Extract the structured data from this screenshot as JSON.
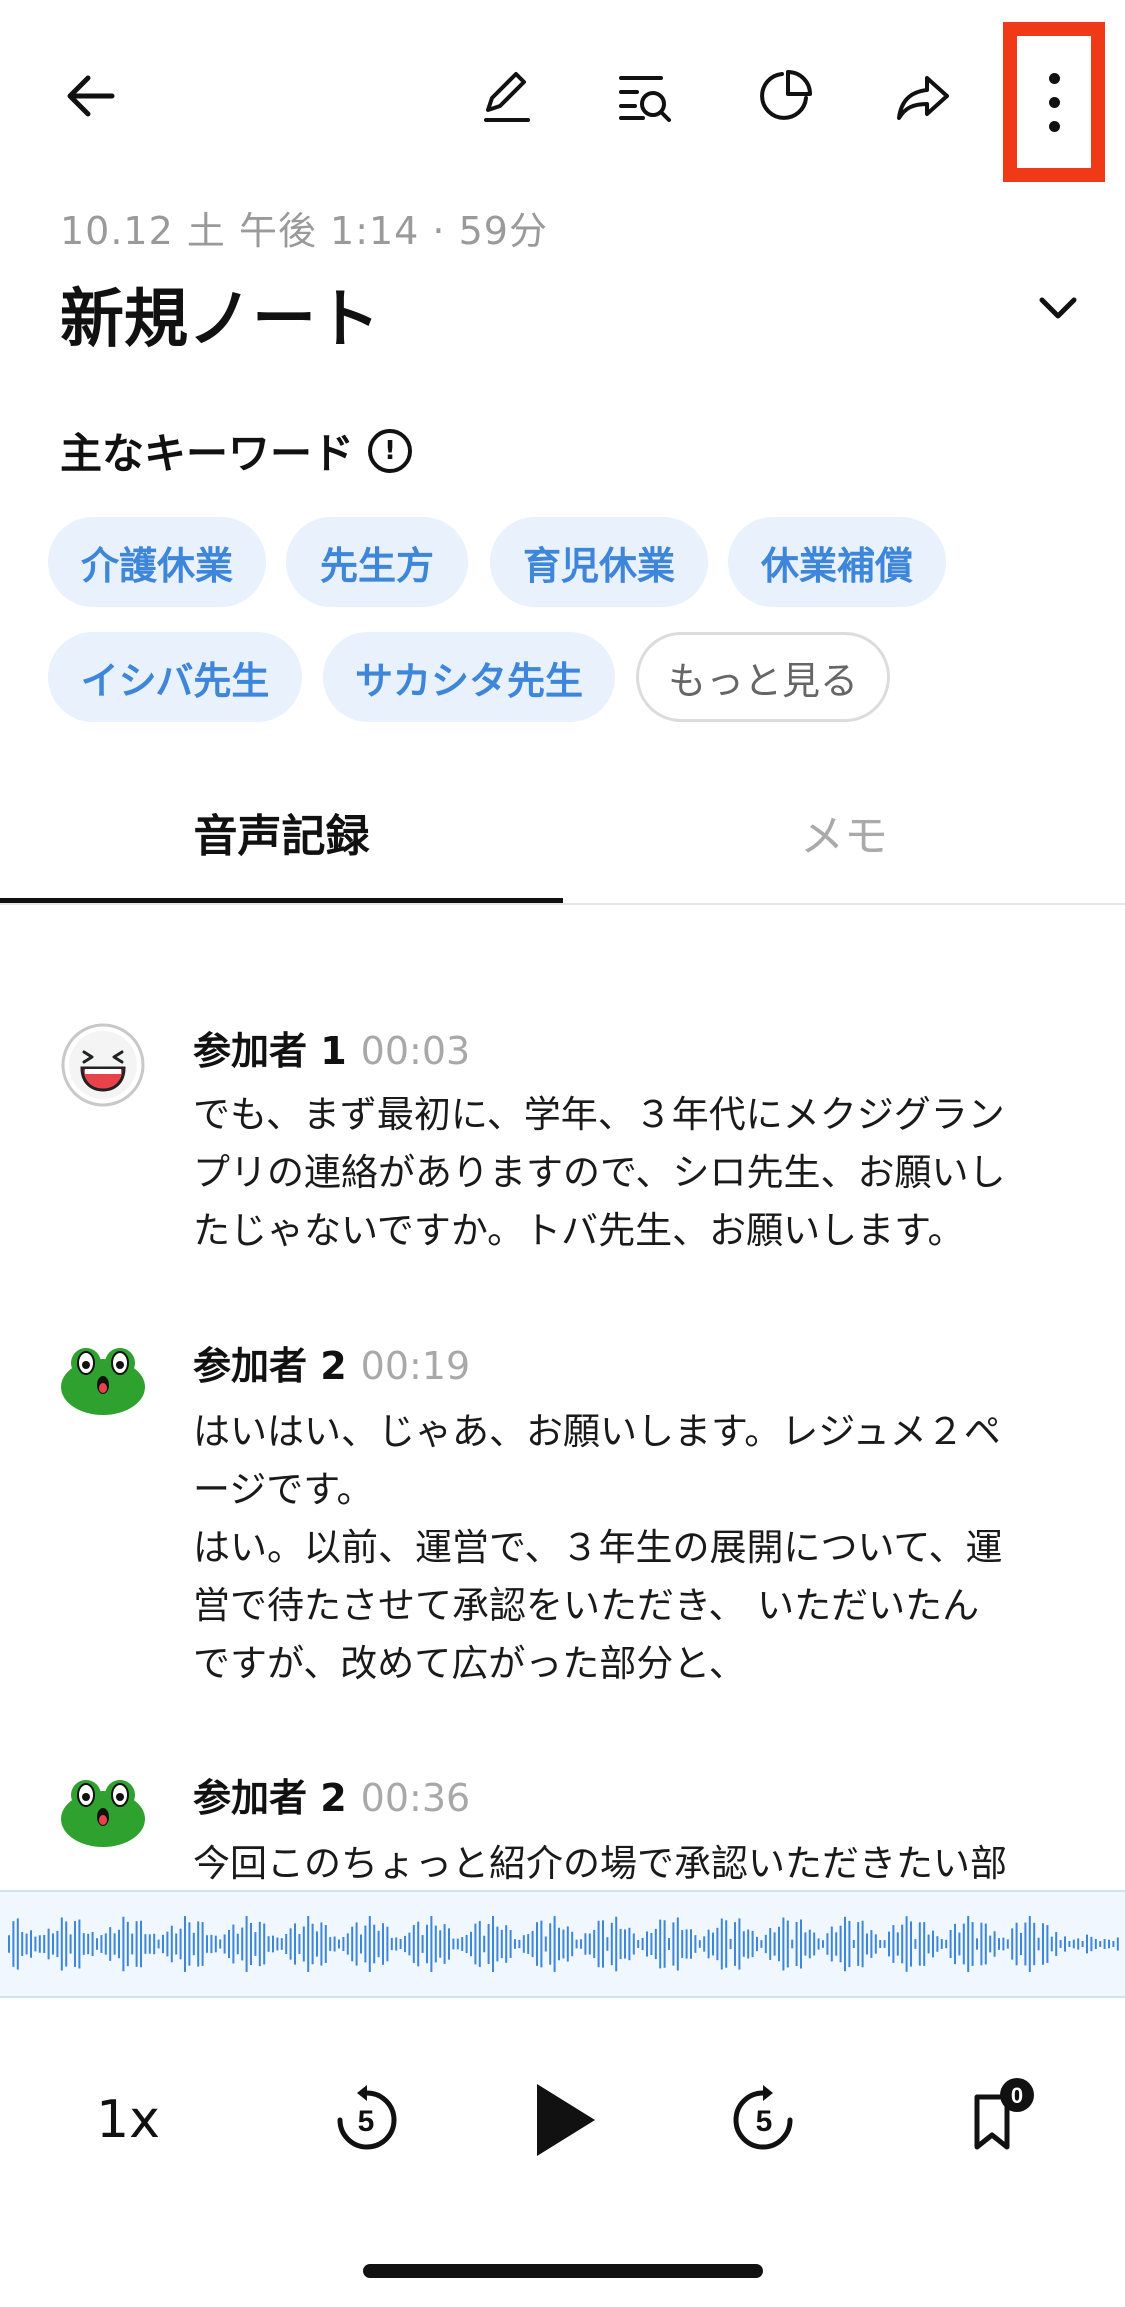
{
  "header": {
    "icons": [
      "back-arrow-icon",
      "edit-pencil-icon",
      "search-list-icon",
      "pie-chart-icon",
      "share-arrow-icon",
      "more-vertical-icon"
    ]
  },
  "note": {
    "meta": "10.12 土 午後 1:14 · 59分",
    "title": "新規ノート"
  },
  "keywords": {
    "heading": "主なキーワード",
    "info_symbol": "!",
    "chips": [
      "介護休業",
      "先生方",
      "育児休業",
      "休業補償",
      "イシバ先生",
      "サカシタ先生"
    ],
    "more_label": "もっと見る"
  },
  "tabs": {
    "items": [
      {
        "label": "音声記録",
        "active": true
      },
      {
        "label": "メモ",
        "active": false
      }
    ]
  },
  "transcript": [
    {
      "speaker": "参加者 1",
      "time": "00:03",
      "avatar": "laughing-face-icon",
      "text": "でも、まず最初に、学年、３年代にメクジグラン\nプリの連絡がありますので、シロ先生、お願いし\nたじゃないですか。トバ先生、お願いします。"
    },
    {
      "speaker": "参加者 2",
      "time": "00:19",
      "avatar": "frog-face-icon",
      "text": "はいはい、じゃあ、お願いします。レジュメ２ペ\nージです。\nはい。以前、運営で、３年生の展開について、運\n営で待たさせて承認をいただき、 いただいたん\nですが、改めて広がった部分と、"
    },
    {
      "speaker": "参加者 2",
      "time": "00:36",
      "avatar": "frog-face-icon",
      "text": "今回このちょっと紹介の場で承認いただきたい部\n分については赤字で記載させてもらっておりま"
    }
  ],
  "player": {
    "speed_label": "1x",
    "rewind_seconds": "5",
    "forward_seconds": "5",
    "bookmark_count": "0",
    "accent_color": "#3d86d9",
    "highlight_color": "#f03a17"
  }
}
